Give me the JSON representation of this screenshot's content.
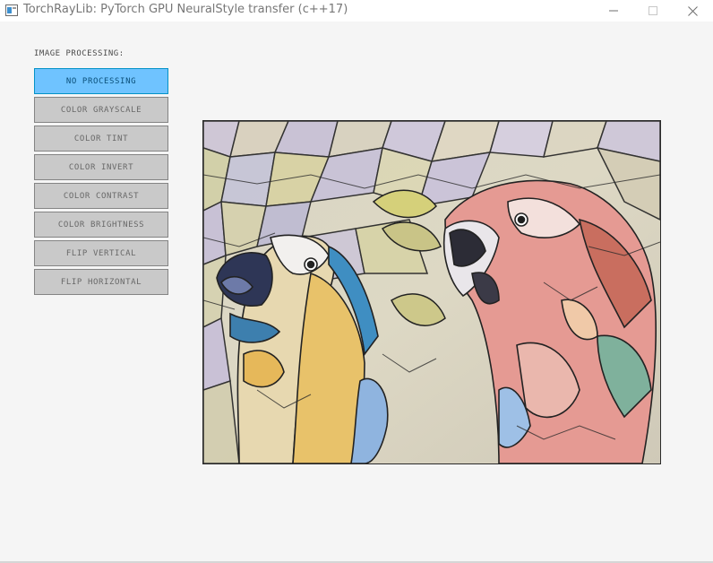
{
  "window": {
    "title": "TorchRayLib: PyTorch GPU NeuralStyle transfer (c++17)"
  },
  "panel": {
    "section_label": "IMAGE PROCESSING:",
    "buttons": [
      {
        "label": "NO PROCESSING",
        "active": true
      },
      {
        "label": "COLOR GRAYSCALE",
        "active": false
      },
      {
        "label": "COLOR TINT",
        "active": false
      },
      {
        "label": "COLOR INVERT",
        "active": false
      },
      {
        "label": "COLOR CONTRAST",
        "active": false
      },
      {
        "label": "COLOR BRIGHTNESS",
        "active": false
      },
      {
        "label": "FLIP VERTICAL",
        "active": false
      },
      {
        "label": "FLIP HORIZONTAL",
        "active": false
      }
    ]
  },
  "colors": {
    "active_button": "#6fc3ff",
    "button": "#c9c9c9"
  },
  "icons": [
    "app-icon",
    "minimize-icon",
    "maximize-icon",
    "close-icon"
  ]
}
